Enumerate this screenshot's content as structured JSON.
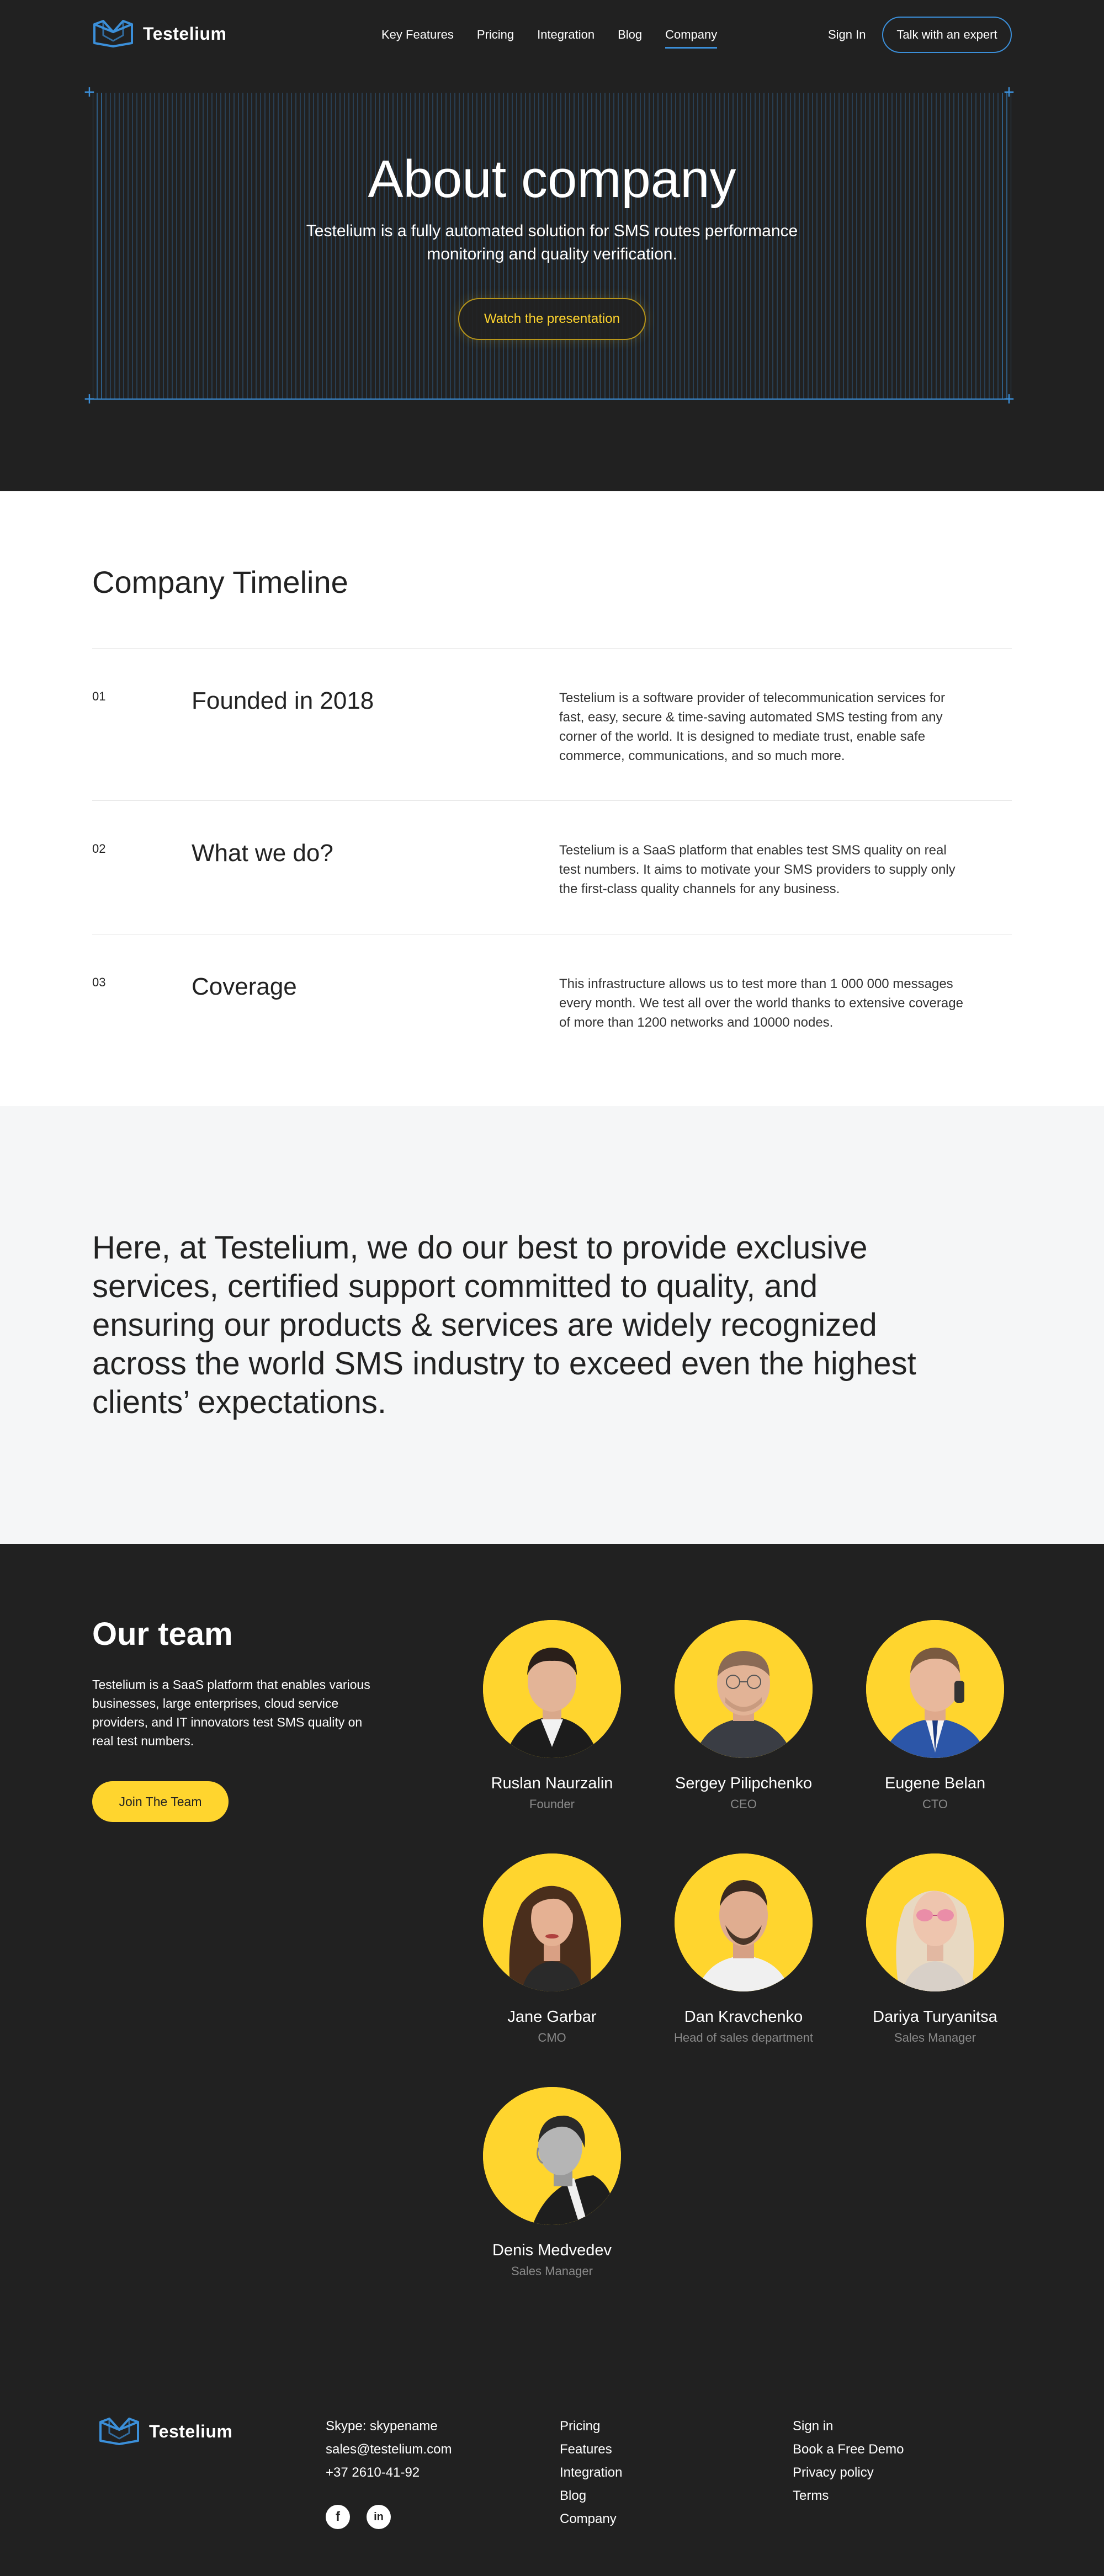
{
  "header": {
    "logo_text": "Testelium",
    "nav": [
      "Key Features",
      "Pricing",
      "Integration",
      "Blog",
      "Company"
    ],
    "active_nav": "Company",
    "sign_in": "Sign In",
    "cta": "Talk with an expert"
  },
  "hero": {
    "title": "About company",
    "subtitle": "Testelium is a fully automated solution for SMS routes performance monitoring and quality verification.",
    "button": "Watch the presentation"
  },
  "timeline": {
    "title": "Company Timeline",
    "items": [
      {
        "num": "01",
        "heading": "Founded in 2018",
        "text": "Testelium is a software provider of telecommunication services for fast, easy, secure & time-saving automated SMS testing from any corner of the world. It is designed to mediate trust, enable safe commerce, communications, and so much more."
      },
      {
        "num": "02",
        "heading": "What we do?",
        "text": "Testelium is a SaaS platform that enables test SMS quality on real test numbers. It aims to motivate your SMS providers to supply only the first-class quality channels for any business."
      },
      {
        "num": "03",
        "heading": "Coverage",
        "text": "This infrastructure allows us to test more than 1 000 000 messages every month. We test all over the world thanks to extensive coverage of more than 1200 networks and 10000 nodes."
      }
    ]
  },
  "mission": {
    "text": "Here, at Testelium, we do our best to provide exclusive services, certified support committed to quality, and ensuring our products & services are widely recognized across the world SMS industry to exceed even the highest clients’ expectations."
  },
  "team": {
    "title": "Our team",
    "description": "Testelium is a SaaS platform that enables various businesses, large enterprises, cloud service providers, and IT innovators test SMS quality on real test numbers.",
    "button": "Join The Team",
    "members": [
      {
        "name": "Ruslan Naurzalin",
        "role": "Founder"
      },
      {
        "name": "Sergey Pilipchenko",
        "role": "CEO"
      },
      {
        "name": "Eugene Belan",
        "role": "CTO"
      },
      {
        "name": "Jane Garbar",
        "role": "CMO"
      },
      {
        "name": "Dan Kravchenko",
        "role": "Head of sales department"
      },
      {
        "name": "Dariya Turyanitsa",
        "role": "Sales Manager"
      },
      {
        "name": "Denis Medvedev",
        "role": "Sales Manager"
      }
    ]
  },
  "footer": {
    "logo_text": "Testelium",
    "contacts": [
      "Skype: skypename",
      "sales@testelium.com",
      "+37 2610-41-92"
    ],
    "links_1": [
      "Pricing",
      "Features",
      "Integration",
      "Blog",
      "Company"
    ],
    "links_2": [
      "Sign in",
      "Book a Free Demo",
      "Privacy policy",
      "Terms"
    ],
    "social_icons": [
      "facebook-icon",
      "linkedin-icon"
    ]
  },
  "colors": {
    "dark_bg": "#212121",
    "accent_blue": "#3b8fd9",
    "accent_yellow": "#ffd52e",
    "light_section": "#f5f6f7"
  }
}
